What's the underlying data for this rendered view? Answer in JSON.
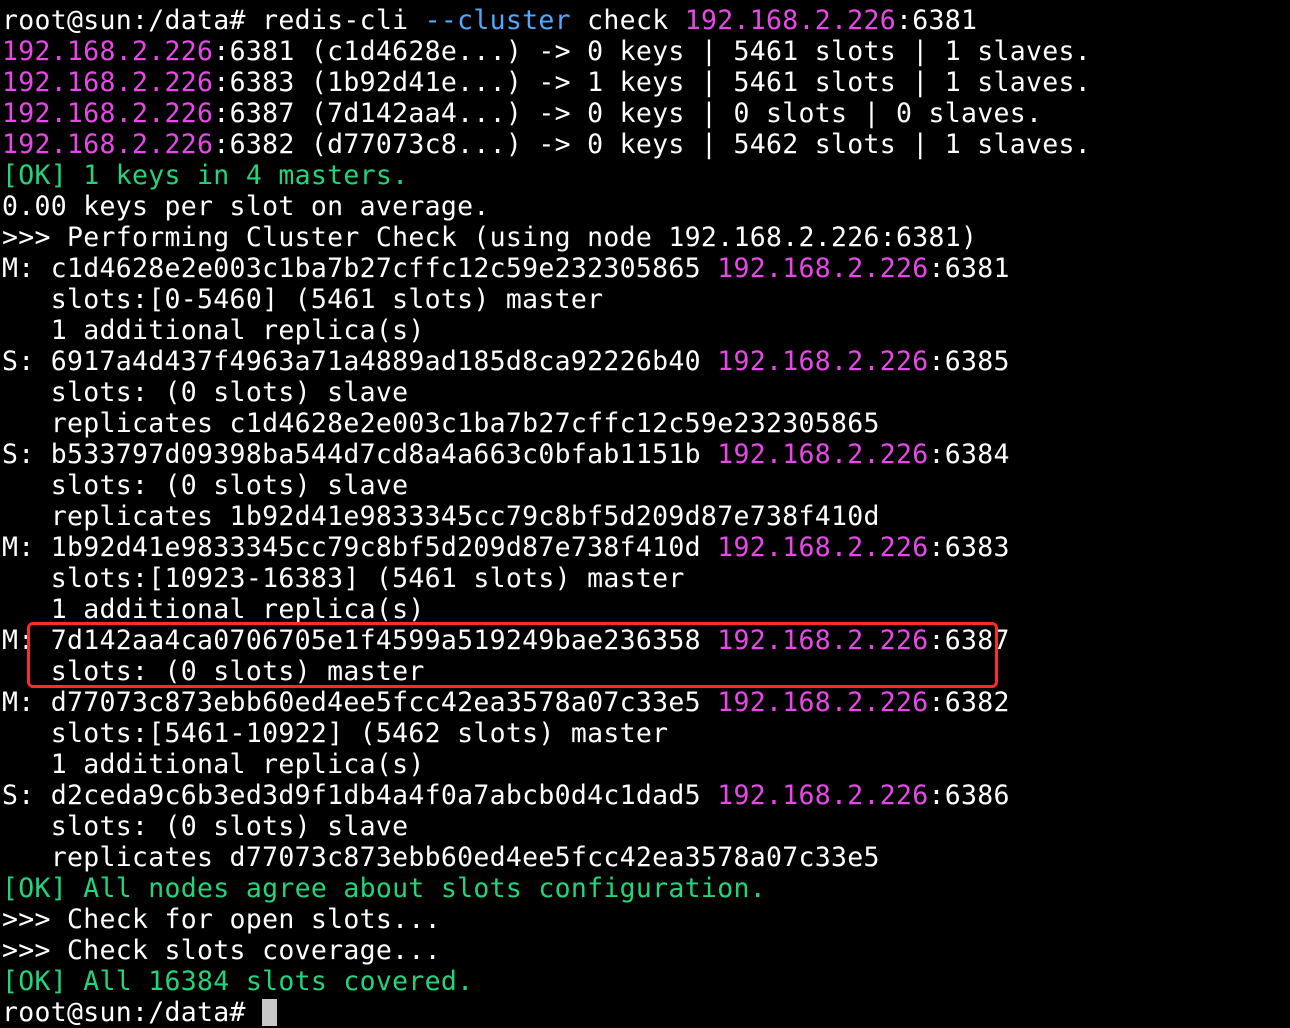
{
  "colors": {
    "background": "#000000",
    "text": "#ffffff",
    "ip": "#e848e8",
    "ok": "#22d47a",
    "flag": "#4fa9ff",
    "highlight": "#ff2a2a",
    "cursor": "#c8c8c8"
  },
  "command": {
    "prompt": "root@sun:/data# ",
    "program": "redis-cli ",
    "flag": "--cluster",
    "args": " check ",
    "ip": "192.168.2.226",
    "port": ":6381"
  },
  "node_summary": [
    {
      "ip": "192.168.2.226",
      "rest": ":6381 (c1d4628e...) -> 0 keys | 5461 slots | 1 slaves."
    },
    {
      "ip": "192.168.2.226",
      "rest": ":6383 (1b92d41e...) -> 1 keys | 5461 slots | 1 slaves."
    },
    {
      "ip": "192.168.2.226",
      "rest": ":6387 (7d142aa4...) -> 0 keys | 0 slots | 0 slaves."
    },
    {
      "ip": "192.168.2.226",
      "rest": ":6382 (d77073c8...) -> 0 keys | 5462 slots | 1 slaves."
    }
  ],
  "ok_keys": "[OK] 1 keys in 4 masters.",
  "avg_keys": "0.00 keys per slot on average.",
  "performing_check": ">>> Performing Cluster Check (using node 192.168.2.226:6381)",
  "nodes": [
    {
      "prefix": "M: c1d4628e2e003c1ba7b27cffc12c59e232305865 ",
      "ip": "192.168.2.226",
      "port": ":6381",
      "detail1": "   slots:[0-5460] (5461 slots) master",
      "detail2": "   1 additional replica(s)"
    },
    {
      "prefix": "S: 6917a4d437f4963a71a4889ad185d8ca92226b40 ",
      "ip": "192.168.2.226",
      "port": ":6385",
      "detail1": "   slots: (0 slots) slave",
      "detail2": "   replicates c1d4628e2e003c1ba7b27cffc12c59e232305865"
    },
    {
      "prefix": "S: b533797d09398ba544d7cd8a4a663c0bfab1151b ",
      "ip": "192.168.2.226",
      "port": ":6384",
      "detail1": "   slots: (0 slots) slave",
      "detail2": "   replicates 1b92d41e9833345cc79c8bf5d209d87e738f410d"
    },
    {
      "prefix": "M: 1b92d41e9833345cc79c8bf5d209d87e738f410d ",
      "ip": "192.168.2.226",
      "port": ":6383",
      "detail1": "   slots:[10923-16383] (5461 slots) master",
      "detail2": "   1 additional replica(s)"
    },
    {
      "prefix": "M: 7d142aa4ca0706705e1f4599a519249bae236358 ",
      "ip": "192.168.2.226",
      "port": ":6387",
      "detail1": "   slots: (0 slots) master"
    },
    {
      "prefix": "M: d77073c873ebb60ed4ee5fcc42ea3578a07c33e5 ",
      "ip": "192.168.2.226",
      "port": ":6382",
      "detail1": "   slots:[5461-10922] (5462 slots) master",
      "detail2": "   1 additional replica(s)"
    },
    {
      "prefix": "S: d2ceda9c6b3ed3d9f1db4a4f0a7abcb0d4c1dad5 ",
      "ip": "192.168.2.226",
      "port": ":6386",
      "detail1": "   slots: (0 slots) slave",
      "detail2": "   replicates d77073c873ebb60ed4ee5fcc42ea3578a07c33e5"
    }
  ],
  "ok_agree": "[OK] All nodes agree about slots configuration.",
  "check_open": ">>> Check for open slots...",
  "check_coverage": ">>> Check slots coverage...",
  "ok_covered": "[OK] All 16384 slots covered.",
  "final_prompt": "root@sun:/data# "
}
